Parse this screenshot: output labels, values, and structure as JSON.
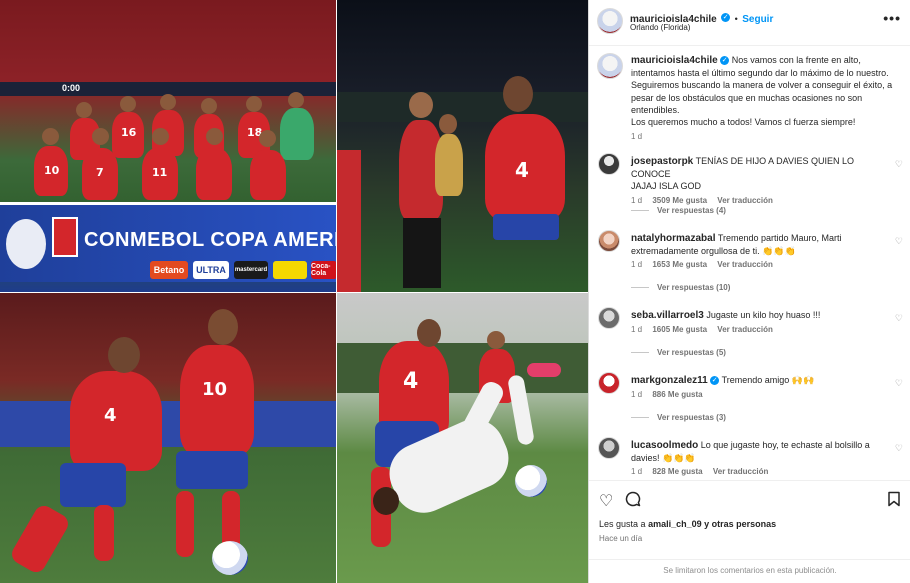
{
  "photos": {
    "banner_text": "CONMEBOL COPA AMERICA",
    "scoreboard": "0:00",
    "sponsors": [
      "Betano",
      "ULTRA",
      "mastercard",
      "",
      "Coca-Cola"
    ],
    "numbers": {
      "p1": [
        "7",
        "11",
        "16",
        "18",
        "10",
        "4"
      ],
      "p2": [
        "4"
      ],
      "p3": [
        "4",
        "10"
      ],
      "p4": [
        "4"
      ]
    }
  },
  "post": {
    "username": "mauricioisla4chile",
    "follow_label": "Seguir",
    "location": "Orlando (Florida)",
    "more_icon": "more-options-icon",
    "caption": {
      "username": "mauricioisla4chile",
      "lines": [
        "Nos vamos con la frente en alto,",
        "intentamos hasta el último segundo dar lo máximo de lo nuestro.",
        "Seguiremos buscando la manera de volver a conseguir el éxito, a",
        "pesar de los obstáculos que en muchas ocasiones no son",
        "entendibles.",
        "Los queremos mucho a todos! Vamos cl fuerza siempre!"
      ],
      "time": "1 d"
    },
    "comments": [
      {
        "username": "josepastorpk",
        "verified": false,
        "text_lines": [
          "TENÍAS DE HIJO A DAVIES QUIEN LO CONOCE",
          "JAJAJ ISLA GOD"
        ],
        "time": "1 d",
        "likes": "3509 Me gusta",
        "translate": "Ver traducción",
        "replies": "Ver respuestas (4)"
      },
      {
        "username": "natalyhormazabal",
        "verified": false,
        "text_lines": [
          "Tremendo partido Mauro, Marti",
          "extremadamente orgullosa de ti. 👏👏👏"
        ],
        "time": "1 d",
        "likes": "1653 Me gusta",
        "translate": "Ver traducción",
        "replies": "Ver respuestas (10)"
      },
      {
        "username": "seba.villarroel3",
        "verified": false,
        "text_lines": [
          "Jugaste un kilo hoy huaso !!!"
        ],
        "time": "1 d",
        "likes": "1605 Me gusta",
        "translate": "Ver traducción",
        "replies": "Ver respuestas (5)"
      },
      {
        "username": "markgonzalez11",
        "verified": true,
        "text_lines": [
          "Tremendo amigo 🙌🙌"
        ],
        "time": "1 d",
        "likes": "886 Me gusta",
        "translate": "",
        "replies": "Ver respuestas (3)"
      },
      {
        "username": "lucasoolmedo",
        "verified": false,
        "text_lines": [
          "Lo que jugaste hoy, te echaste al bolsillo a",
          "davies! 👏👏👏"
        ],
        "time": "1 d",
        "likes": "828 Me gusta",
        "translate": "Ver traducción",
        "replies": ""
      }
    ],
    "actions": {
      "like_icon": "heart-icon",
      "comment_icon": "comment-icon",
      "save_icon": "bookmark-icon"
    },
    "likes_prefix": "Les gusta a",
    "likes_user": "amali_ch_09",
    "likes_suffix": "y otras personas",
    "posted_when": "Hace un día",
    "comments_limited": "Se limitaron los comentarios en esta publicación."
  },
  "colors": {
    "accent": "#0095f6",
    "chile_red": "#d3262b",
    "chile_blue": "#2745a8"
  }
}
